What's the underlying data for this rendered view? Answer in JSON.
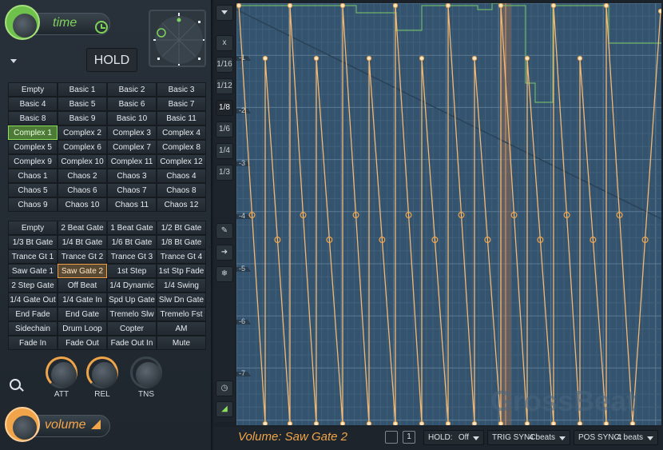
{
  "time_knob": {
    "label": "time"
  },
  "volume_knob": {
    "label": "volume"
  },
  "hold_button": "HOLD",
  "time_presets": [
    "Empty",
    "Basic 1",
    "Basic 2",
    "Basic 3",
    "Basic 4",
    "Basic 5",
    "Basic 6",
    "Basic 7",
    "Basic 8",
    "Basic 9",
    "Basic 10",
    "Basic 11",
    "Complex 1",
    "Complex 2",
    "Complex 3",
    "Complex 4",
    "Complex 5",
    "Complex 6",
    "Complex 7",
    "Complex 8",
    "Complex 9",
    "Complex 10",
    "Complex 11",
    "Complex 12",
    "Chaos 1",
    "Chaos 2",
    "Chaos 3",
    "Chaos 4",
    "Chaos 5",
    "Chaos 6",
    "Chaos 7",
    "Chaos 8",
    "Chaos 9",
    "Chaos 10",
    "Chaos 11",
    "Chaos 12"
  ],
  "time_selected": "Complex 1",
  "volume_presets": [
    "Empty",
    "2 Beat Gate",
    "1 Beat Gate",
    "1/2 Bt Gate",
    "1/3 Bt Gate",
    "1/4 Bt Gate",
    "1/6 Bt Gate",
    "1/8 Bt Gate",
    "Trance Gt 1",
    "Trance Gt 2",
    "Trance Gt 3",
    "Trance Gt 4",
    "Saw Gate 1",
    "Saw Gate 2",
    "1st Step",
    "1st Stp Fade",
    "2 Step Gate",
    "Off Beat",
    "1/4 Dynamic",
    "1/4 Swing",
    "1/4 Gate Out",
    "1/4 Gate In",
    "Spd Up Gate",
    "Slw Dn Gate",
    "End Fade",
    "End Gate",
    "Tremelo Slw",
    "Tremelo Fst",
    "Sidechain",
    "Drum Loop",
    "Copter",
    "AM",
    "Fade In",
    "Fade Out",
    "Fade Out In",
    "Mute"
  ],
  "volume_selected": "Saw Gate 2",
  "knobs": [
    {
      "name": "att",
      "label": "ATT"
    },
    {
      "name": "rel",
      "label": "REL"
    },
    {
      "name": "tns",
      "label": "TNS"
    }
  ],
  "side_buttons": [
    "x",
    "1/16",
    "1/12",
    "1/8",
    "1/6",
    "1/4",
    "1/3"
  ],
  "side_selected": "1/8",
  "db_labels": [
    "-1",
    "-2",
    "-3",
    "-4",
    "-5",
    "-6",
    "-7"
  ],
  "watermark": "GrossBeat",
  "status": "Volume: Saw Gate 2",
  "one_button": "1",
  "hold": {
    "label": "HOLD:",
    "value": "Off"
  },
  "trig_sync": {
    "label": "TRIG SYNC:",
    "value": "4 beats"
  },
  "pos_sync": {
    "label": "POS SYNC:",
    "value": "4 beats"
  },
  "colors": {
    "green": "#7fd35b",
    "orange": "#f0a54a",
    "graph_bg": "#34536e"
  }
}
